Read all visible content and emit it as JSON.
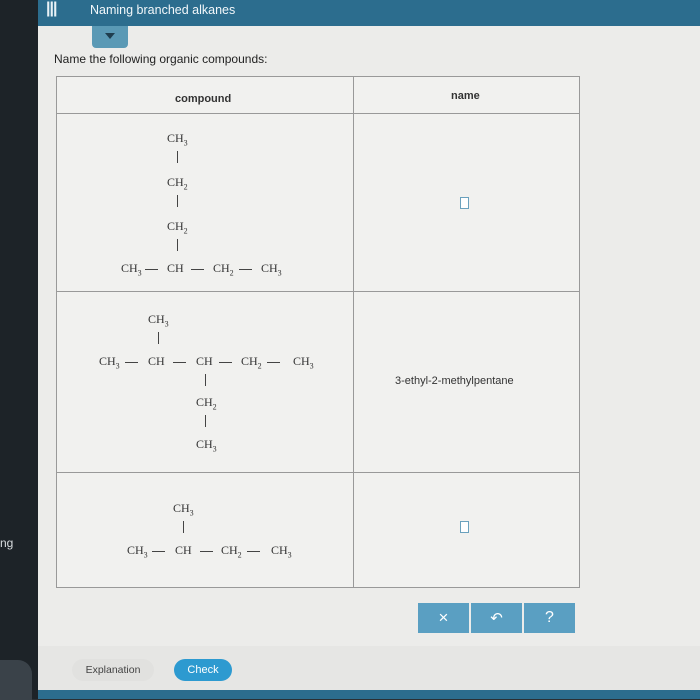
{
  "header": {
    "title": "Naming branched alkanes"
  },
  "side": {
    "fragment_text": "ng"
  },
  "prompt": "Name the following organic compounds:",
  "table": {
    "headers": {
      "compound": "compound",
      "name": "name"
    },
    "chem": {
      "ch3": "CH",
      "ch2": "CH",
      "ch": "CH",
      "sub3": "3",
      "sub2": "2",
      "dash": "—"
    },
    "rows": [
      {
        "answer": ""
      },
      {
        "answer": "3-ethyl-2-methylpentane"
      },
      {
        "answer": ""
      }
    ]
  },
  "toolbar": {
    "close": "×",
    "undo": "↶",
    "help": "?"
  },
  "footer": {
    "explanation": "Explanation",
    "check": "Check"
  },
  "colors": {
    "accent": "#2c6d8e",
    "button": "#5a9fc2",
    "check": "#2d9ad0"
  }
}
